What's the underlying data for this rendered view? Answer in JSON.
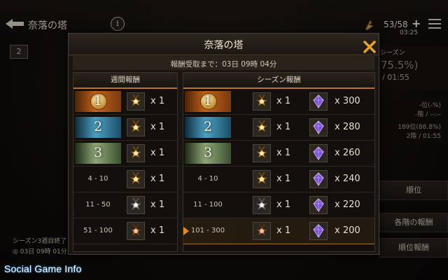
{
  "header": {
    "title": "奈落の塔",
    "info_label": "i",
    "stamina": "53/58",
    "stamina_plus": "+",
    "stamina_timer": "03:25"
  },
  "background": {
    "floor_badge": "2",
    "side": {
      "season_label": "シーズン",
      "percent": "(75.5%)",
      "time": "/ 01:55",
      "stat_1": "-位(-%)",
      "stat_2": "-階 / --:--",
      "stat_3": "189位(88.8%)",
      "stat_4": "2階 / 01:55"
    },
    "buttons": [
      "順位",
      "各階の報酬",
      "順位報酬"
    ],
    "bottom_line1": "シーズン3週目終了",
    "bottom_line2": "◎ 03日 09時 01分"
  },
  "watermark": "Social Game Info",
  "modal": {
    "title": "奈落の塔",
    "reward_timer": "報酬受取まで：03日 09時 04分",
    "weekly": {
      "header": "週間報酬",
      "rows": [
        {
          "rank": "1",
          "style": "gold",
          "qty": "x 1",
          "item": "gold-medal"
        },
        {
          "rank": "2",
          "style": "silver",
          "qty": "x 1",
          "item": "gold-medal"
        },
        {
          "rank": "3",
          "style": "bronze",
          "qty": "x 1",
          "item": "gold-medal"
        },
        {
          "rank": "4 - 10",
          "style": "plain",
          "qty": "x 1",
          "item": "gold-medal"
        },
        {
          "rank": "11 - 50",
          "style": "plain",
          "qty": "x 1",
          "item": "silver-medal"
        },
        {
          "rank": "51 - 100",
          "style": "plain",
          "qty": "x 1",
          "item": "bronze-medal"
        }
      ]
    },
    "season": {
      "header": "シーズン報酬",
      "rows": [
        {
          "rank": "1",
          "style": "gold",
          "qty1": "x 1",
          "qty2": "x 300",
          "item1": "gold-medal"
        },
        {
          "rank": "2",
          "style": "silver",
          "qty1": "x 1",
          "qty2": "x 280",
          "item1": "gold-medal"
        },
        {
          "rank": "3",
          "style": "bronze",
          "qty1": "x 1",
          "qty2": "x 260",
          "item1": "gold-medal"
        },
        {
          "rank": "4 - 10",
          "style": "plain",
          "qty1": "x 1",
          "qty2": "x 240",
          "item1": "gold-medal"
        },
        {
          "rank": "11 - 100",
          "style": "plain",
          "qty1": "x 1",
          "qty2": "x 220",
          "item1": "silver-medal"
        },
        {
          "rank": "101 - 300",
          "style": "selected",
          "qty1": "x 1",
          "qty2": "x 200",
          "item1": "bronze-medal"
        }
      ]
    }
  },
  "colors": {
    "accent": "#b67a25",
    "close": "#e8a12a",
    "gem": "#7a4fd0"
  }
}
